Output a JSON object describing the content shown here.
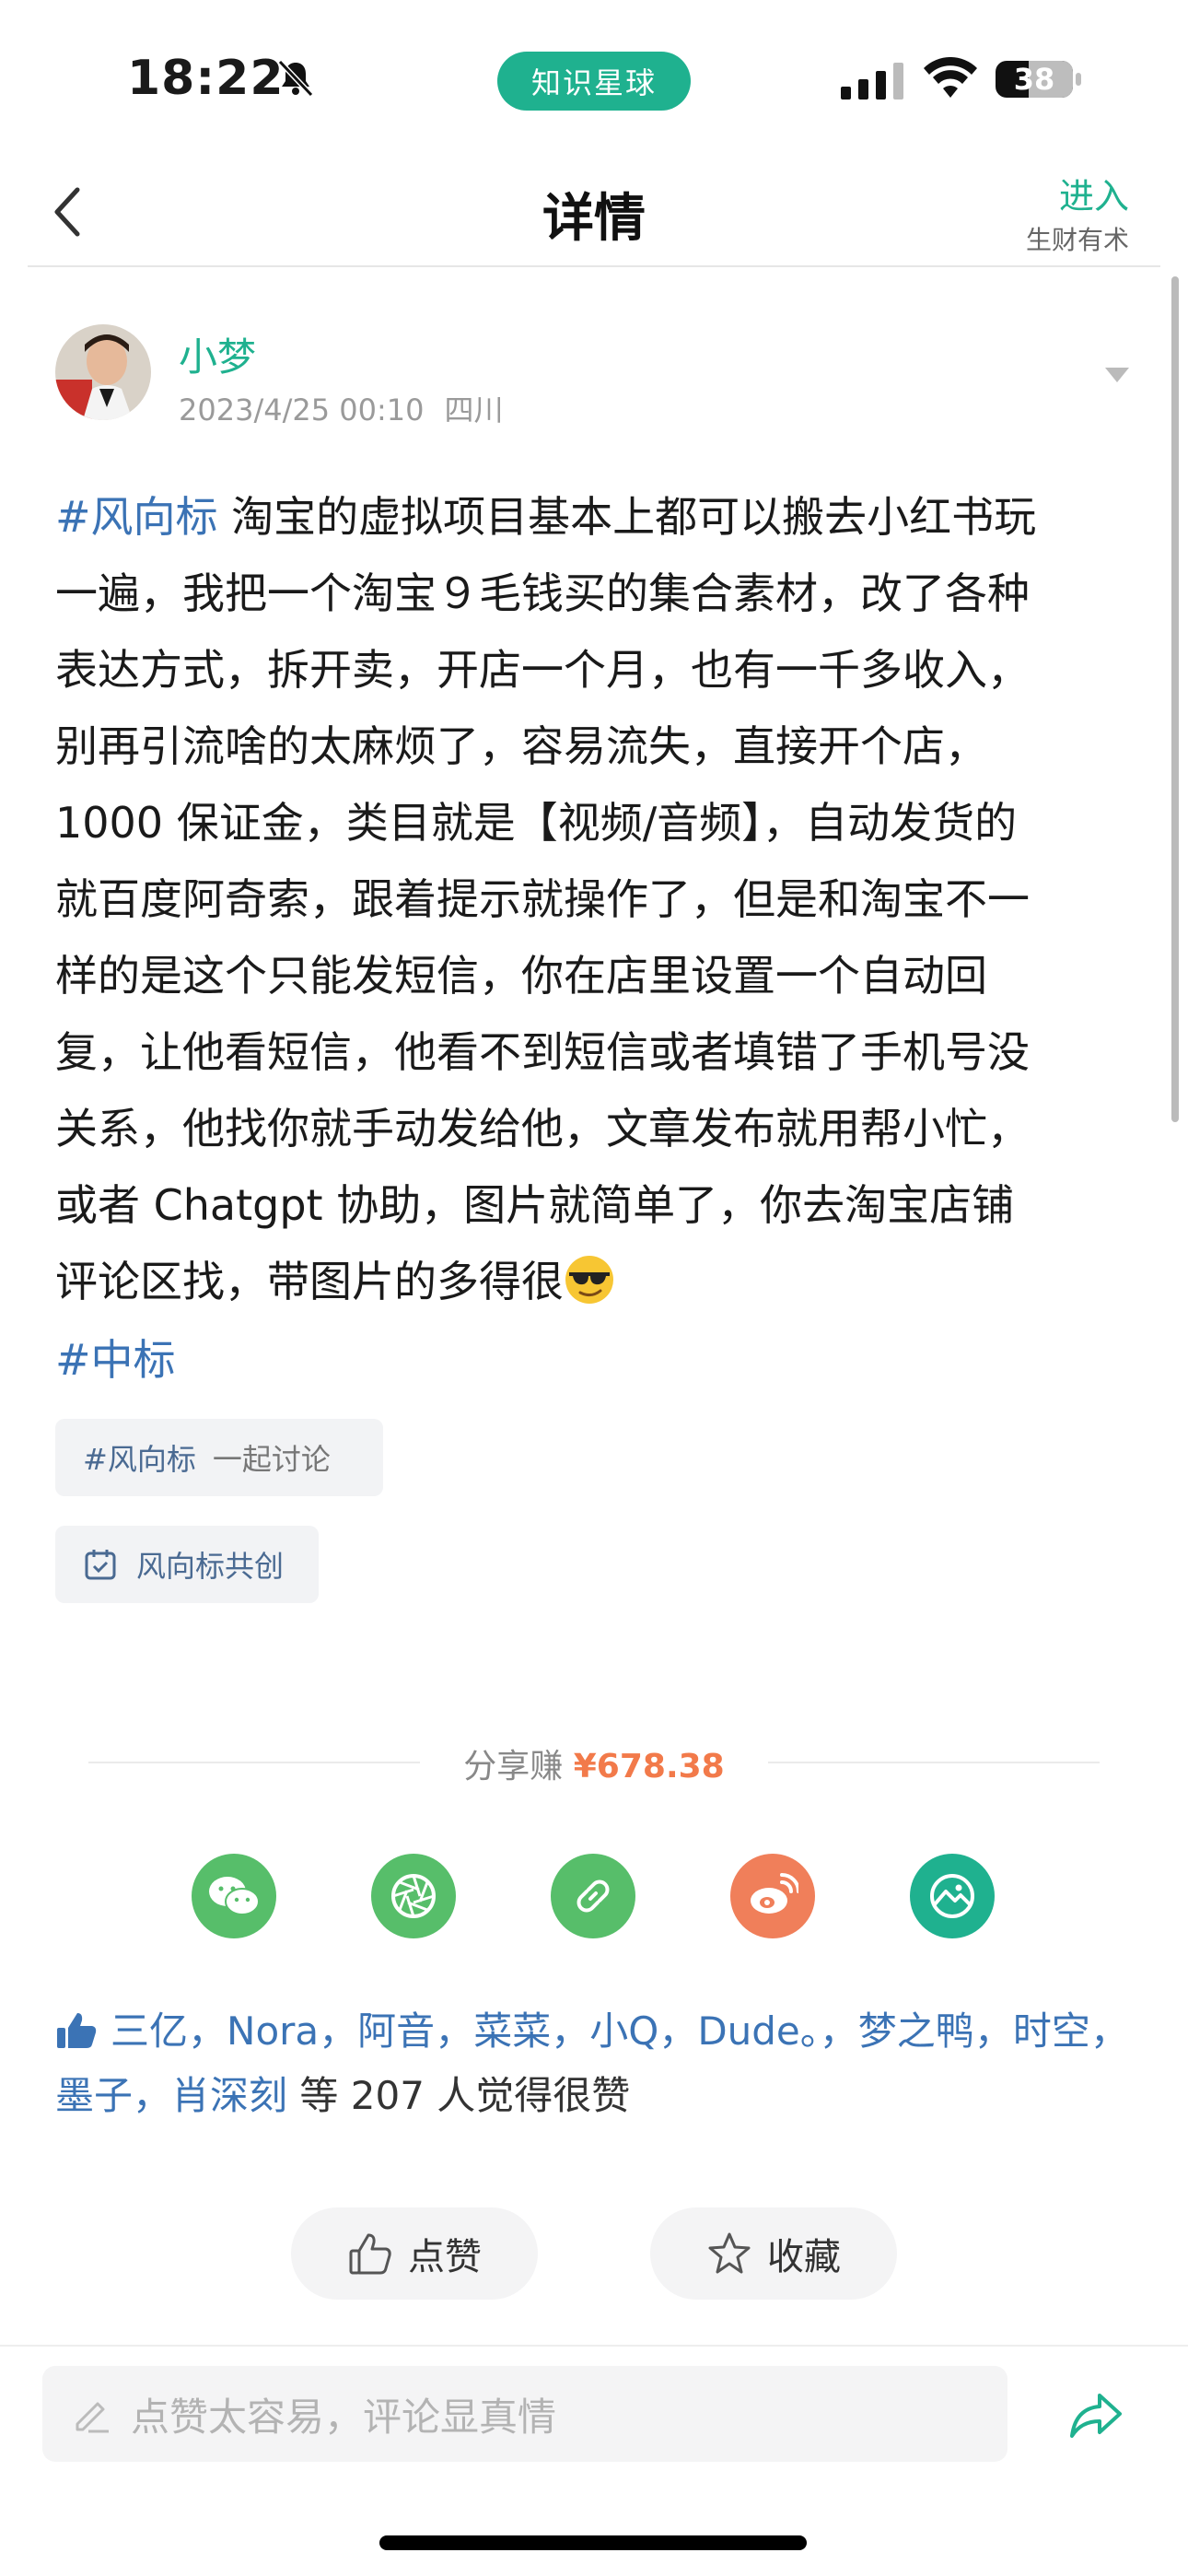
{
  "status_bar": {
    "time": "18:22",
    "app_pill": "知识星球",
    "battery": "38",
    "icons": [
      "bell-muted-icon",
      "signal-icon",
      "wifi-icon",
      "battery-icon"
    ]
  },
  "nav": {
    "title": "详情",
    "enter_label": "进入",
    "enter_sub": "生财有术"
  },
  "post": {
    "author": "小梦",
    "date": "2023/4/25 00:10",
    "location": "四川",
    "tag_start": "#风向标",
    "body_lines": [
      " 淘宝的虚拟项目基本上都可以搬去小红书玩",
      "一遍，我把一个淘宝９毛钱买的集合素材，改了各种",
      "表达方式，拆开卖，开店一个月，也有一千多收入，",
      "别再引流啥的太麻烦了，容易流失，直接开个店，",
      "1000 保证金，类目就是【视频/音频】，自动发货的",
      "就百度阿奇索，跟着提示就操作了，但是和淘宝不一",
      "样的是这个只能发短信，你在店里设置一个自动回",
      "复，让他看短信，他看不到短信或者填错了手机号没",
      "关系，他找你就手动发给他，文章发布就用帮小忙，",
      "或者 Chatgpt 协助，图片就简单了，你去淘宝店铺",
      "评论区找，带图片的多得很"
    ],
    "tag_end": "#中标",
    "chip_tag": "#风向标",
    "chip_tag_sub": "一起讨论",
    "chip_cocreate": "风向标共创"
  },
  "share": {
    "earn_label": "分享赚",
    "earn_amount": "¥678.38",
    "buttons": [
      {
        "name": "wechat-icon",
        "color": "#57be6a"
      },
      {
        "name": "moments-icon",
        "color": "#57be6a"
      },
      {
        "name": "link-icon",
        "color": "#57be6a"
      },
      {
        "name": "weibo-icon",
        "color": "#f07f5a"
      },
      {
        "name": "image-icon",
        "color": "#1fb18f"
      }
    ]
  },
  "likes": {
    "names": [
      "三亿",
      "Nora",
      "阿音",
      "菜菜",
      "小Q",
      "Dude。",
      "梦之鸭",
      "时空",
      "墨子",
      "肖深刻"
    ],
    "suffix": " 等 207 人觉得很赞"
  },
  "actions": {
    "like_label": "点赞",
    "favorite_label": "收藏"
  },
  "comment": {
    "placeholder": "点赞太容易，评论显真情"
  }
}
